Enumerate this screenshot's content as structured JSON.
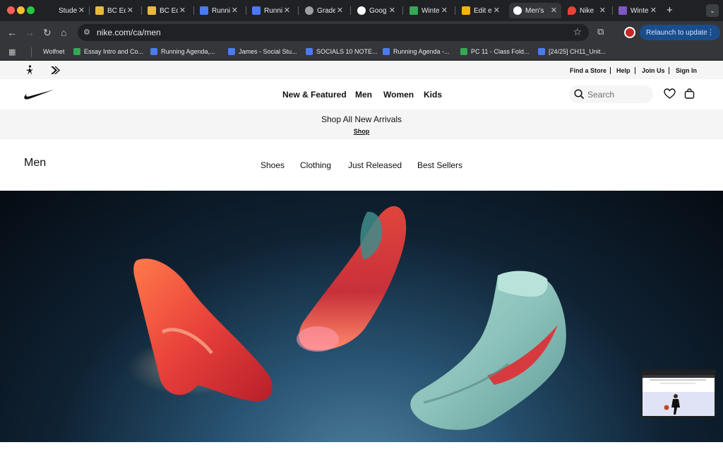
{
  "browser": {
    "tabs": [
      {
        "title": "Stude",
        "icon": "blank-icon",
        "color": "#202124"
      },
      {
        "title": "BC Ed",
        "icon": "bc-icon",
        "color": "#e8b93a"
      },
      {
        "title": "BC Ed",
        "icon": "bc-icon",
        "color": "#e8b93a"
      },
      {
        "title": "Runni",
        "icon": "docs-icon",
        "color": "#4a7bf0"
      },
      {
        "title": "Runni",
        "icon": "docs-icon",
        "color": "#4a7bf0"
      },
      {
        "title": "Grade",
        "icon": "globe-icon",
        "color": "#9aa0a6"
      },
      {
        "title": "Goog",
        "icon": "google-icon",
        "color": "#ffffff"
      },
      {
        "title": "Winte",
        "icon": "drive-icon",
        "color": "#34a853"
      },
      {
        "title": "Edit e",
        "icon": "edit-icon",
        "color": "#f4b400"
      },
      {
        "title": "Men's",
        "icon": "nike-icon",
        "color": "#ffffff",
        "active": true
      },
      {
        "title": "Nike",
        "icon": "maps-icon",
        "color": "#ea4335"
      },
      {
        "title": "Winte",
        "icon": "calendar-icon",
        "color": "#7e57c2"
      }
    ],
    "close_glyph": "✕",
    "new_tab_glyph": "+",
    "url": "nike.com/ca/men",
    "relaunch_label": "Relaunch to update",
    "bookmarks": [
      {
        "label": "Wolfnet",
        "color": ""
      },
      {
        "label": "Essay Intro and Co...",
        "color": "#34a853"
      },
      {
        "label": "Running Agenda,...",
        "color": "#4a7bf0"
      },
      {
        "label": "James - Social Stu...",
        "color": "#4a7bf0"
      },
      {
        "label": "SOCIALS 10 NOTE...",
        "color": "#4a7bf0"
      },
      {
        "label": "Running Agenda -...",
        "color": "#4a7bf0"
      },
      {
        "label": "PC 11 - Class Fold...",
        "color": "#34a853"
      },
      {
        "label": "[24/25] CH11_Unit...",
        "color": "#4a7bf0"
      }
    ]
  },
  "utility": {
    "links": [
      "Find a Store",
      "Help",
      "Join Us",
      "Sign In"
    ]
  },
  "nav": {
    "links": [
      "New & Featured",
      "Men",
      "Women",
      "Kids"
    ],
    "search_placeholder": "Search"
  },
  "promo": {
    "title": "Shop All New Arrivals",
    "link": "Shop"
  },
  "subnav": {
    "title": "Men",
    "links": [
      "Shoes",
      "Clothing",
      "Just Released",
      "Best Sellers"
    ]
  },
  "colors": {
    "nike_black": "#111111",
    "chrome_dark": "#202124",
    "chrome_toolbar": "#35363a",
    "relaunch_blue": "#1a4d8c"
  }
}
